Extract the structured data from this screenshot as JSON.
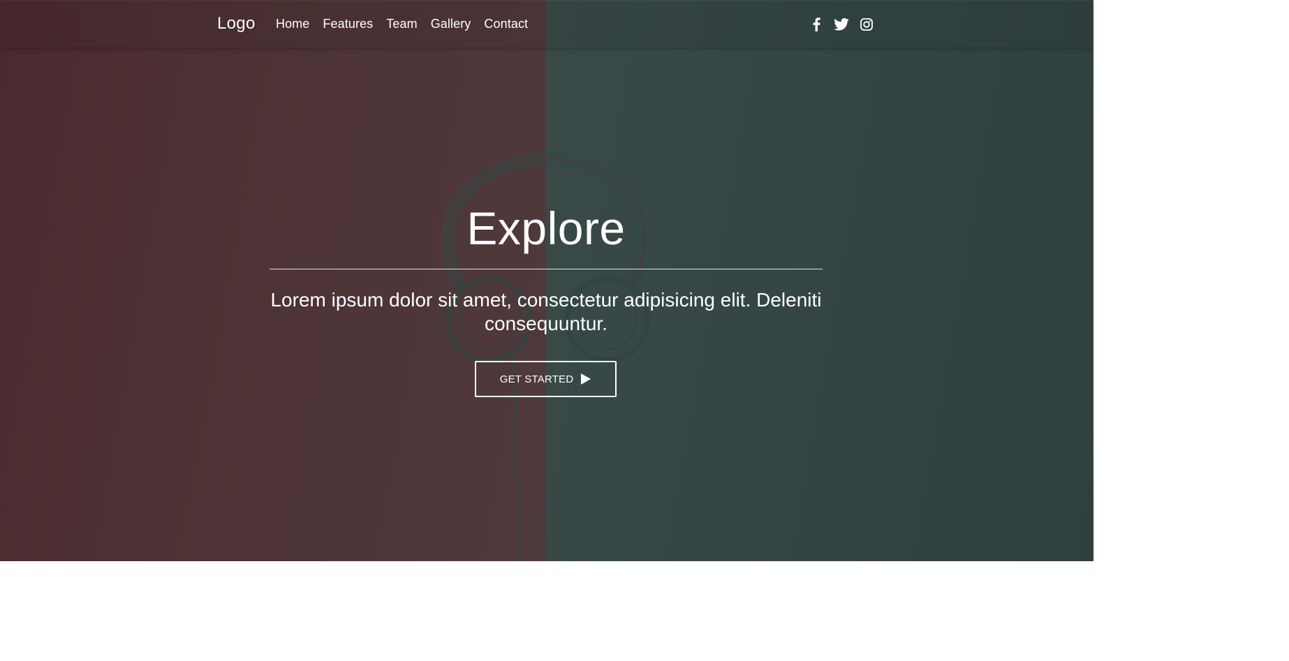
{
  "navbar": {
    "logo": "Logo",
    "links": [
      "Home",
      "Features",
      "Team",
      "Gallery",
      "Contact"
    ],
    "social_icons": [
      "facebook-icon",
      "twitter-icon",
      "instagram-icon"
    ]
  },
  "hero": {
    "title": "Explore",
    "text": "Lorem ipsum dolor sit amet, consectetur adipisicing elit. Deleniti consequuntur.",
    "cta_label": "GET STARTED",
    "cta_icon": "play-icon"
  },
  "colors": {
    "overlay_left": "#4e3436",
    "overlay_right": "#334442",
    "text": "#ffffff"
  }
}
